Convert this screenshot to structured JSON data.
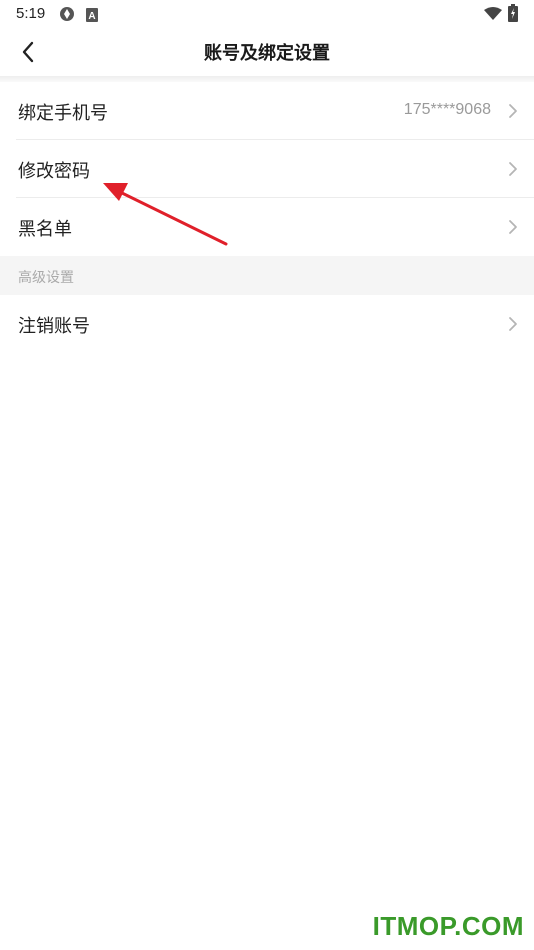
{
  "status_bar": {
    "time": "5:19",
    "icons": [
      "sync-icon",
      "a-notification-icon",
      "wifi-icon",
      "battery-charging-icon"
    ]
  },
  "header": {
    "title": "账号及绑定设置"
  },
  "settings": {
    "rows": [
      {
        "label": "绑定手机号",
        "value": "175****9068"
      },
      {
        "label": "修改密码"
      },
      {
        "label": "黑名单"
      }
    ],
    "advanced_section": {
      "title": "高级设置",
      "rows": [
        {
          "label": "注销账号"
        }
      ]
    }
  },
  "annotation": {
    "arrow_color": "#e0202a"
  },
  "watermark": {
    "text": "ITMOP.COM",
    "color": "#3a9a2a"
  }
}
